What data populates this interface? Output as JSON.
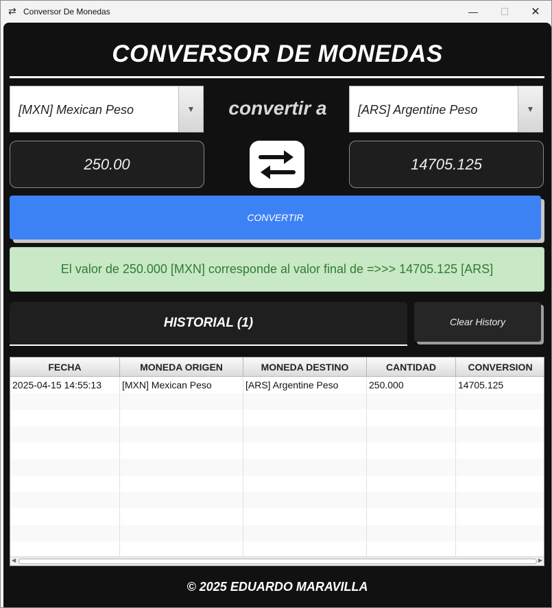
{
  "window": {
    "title": "Conversor De Monedas",
    "icon": "swap-icon",
    "min_glyph": "—",
    "max_glyph": "☐",
    "close_glyph": "✕"
  },
  "header": {
    "title": "CONVERSOR DE MONEDAS"
  },
  "converter": {
    "from_currency": "[MXN] Mexican Peso",
    "to_currency": "[ARS] Argentine Peso",
    "label": "convertir a",
    "amount": "250.00",
    "converted": "14705.125",
    "convert_button": "CONVERTIR",
    "dropdown_glyph": "▼"
  },
  "result": {
    "text": "El valor de 250.000 [MXN] corresponde al valor final de =>>> 14705.125 [ARS]"
  },
  "history": {
    "title": "HISTORIAL (1)",
    "clear_button": "Clear History",
    "columns": [
      "FECHA",
      "MONEDA ORIGEN",
      "MONEDA DESTINO",
      "CANTIDAD",
      "CONVERSION"
    ],
    "rows": [
      [
        "2025-04-15 14:55:13",
        "[MXN] Mexican Peso",
        "[ARS] Argentine Peso",
        "250.000",
        "14705.125"
      ]
    ],
    "empty_rows": 10
  },
  "footer": {
    "text": "© 2025 EDUARDO MARAVILLA"
  },
  "colors": {
    "accent": "#3d82f5",
    "result_bg": "#c9e8c5",
    "result_text": "#2e7d32",
    "panel_bg": "#111111"
  }
}
